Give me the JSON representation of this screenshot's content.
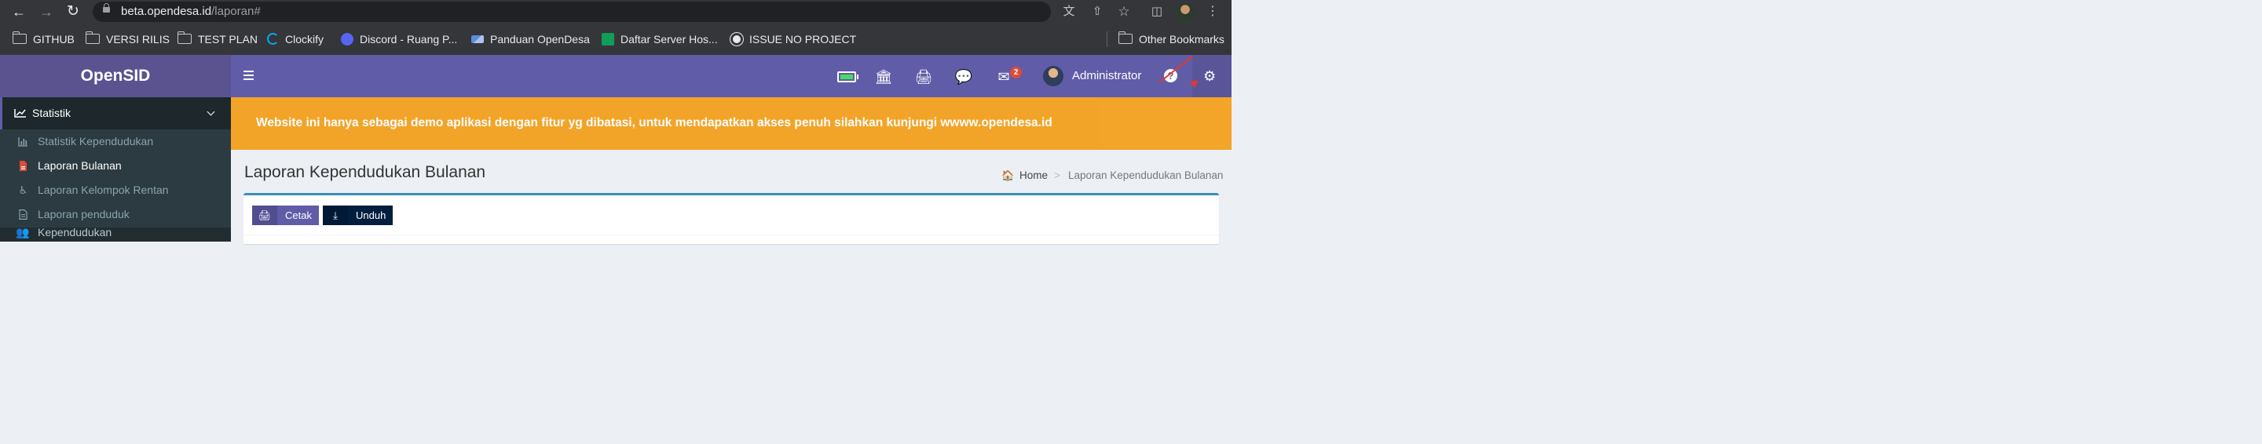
{
  "browser": {
    "url_host": "beta.opendesa.id",
    "url_path": "/laporan#",
    "bookmarks": [
      {
        "label": "GITHUB",
        "icon": "folder-icon"
      },
      {
        "label": "VERSI RILIS",
        "icon": "folder-icon"
      },
      {
        "label": "TEST PLAN",
        "icon": "folder-icon"
      },
      {
        "label": "Clockify",
        "icon": "clockify-icon"
      },
      {
        "label": "Discord - Ruang P...",
        "icon": "discord-icon"
      },
      {
        "label": "Panduan OpenDesa",
        "icon": "opendesa-icon"
      },
      {
        "label": "Daftar Server Hos...",
        "icon": "sheets-icon"
      },
      {
        "label": "ISSUE NO PROJECT",
        "icon": "github-icon"
      }
    ],
    "other_bookmarks": "Other Bookmarks"
  },
  "app": {
    "logo": "OpenSID",
    "mail_badge": "2",
    "user_name": "Administrator"
  },
  "sidebar": {
    "section": "Statistik",
    "items": [
      {
        "label": "Statistik Kependudukan",
        "icon": "bar-chart-icon"
      },
      {
        "label": "Laporan Bulanan",
        "icon": "pdf-file-icon"
      },
      {
        "label": "Laporan Kelompok Rentan",
        "icon": "wheelchair-icon"
      },
      {
        "label": "Laporan penduduk",
        "icon": "document-icon"
      }
    ],
    "next_section": "Kependudukan"
  },
  "notice": "Website ini hanya sebagai demo aplikasi dengan fitur yg dibatasi, untuk mendapatkan akses penuh silahkan kunjungi wwww.opendesa.id",
  "page": {
    "title": "Laporan Kependudukan Bulanan",
    "breadcrumb": {
      "home": "Home",
      "separator": ">",
      "current": "Laporan Kependudukan Bulanan"
    }
  },
  "toolbar": {
    "print_label": "Cetak",
    "download_label": "Unduh"
  },
  "colors": {
    "header": "#605ca8",
    "logo_bg": "#5a5390",
    "sidebar": "#222d32",
    "notice": "#f39c12",
    "box_border": "#3c8dbc",
    "print_button": "#605ca8",
    "download_button": "#001f3f"
  }
}
